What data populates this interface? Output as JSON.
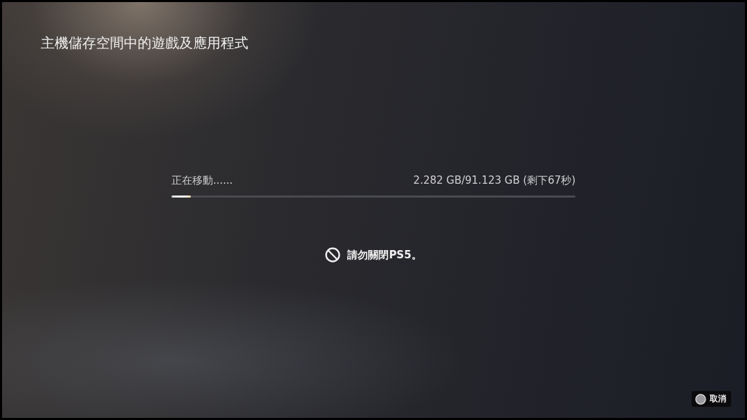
{
  "title": "主機儲存空間中的遊戲及應用程式",
  "progress": {
    "status": "正在移動......",
    "reading": "2.282 GB/91.123 GB (剩下67秒)",
    "level": 0.048
  },
  "warning": "請勿關閉PS5。",
  "buttons": [
    {
      "kind": "circle",
      "label": "取消"
    }
  ]
}
